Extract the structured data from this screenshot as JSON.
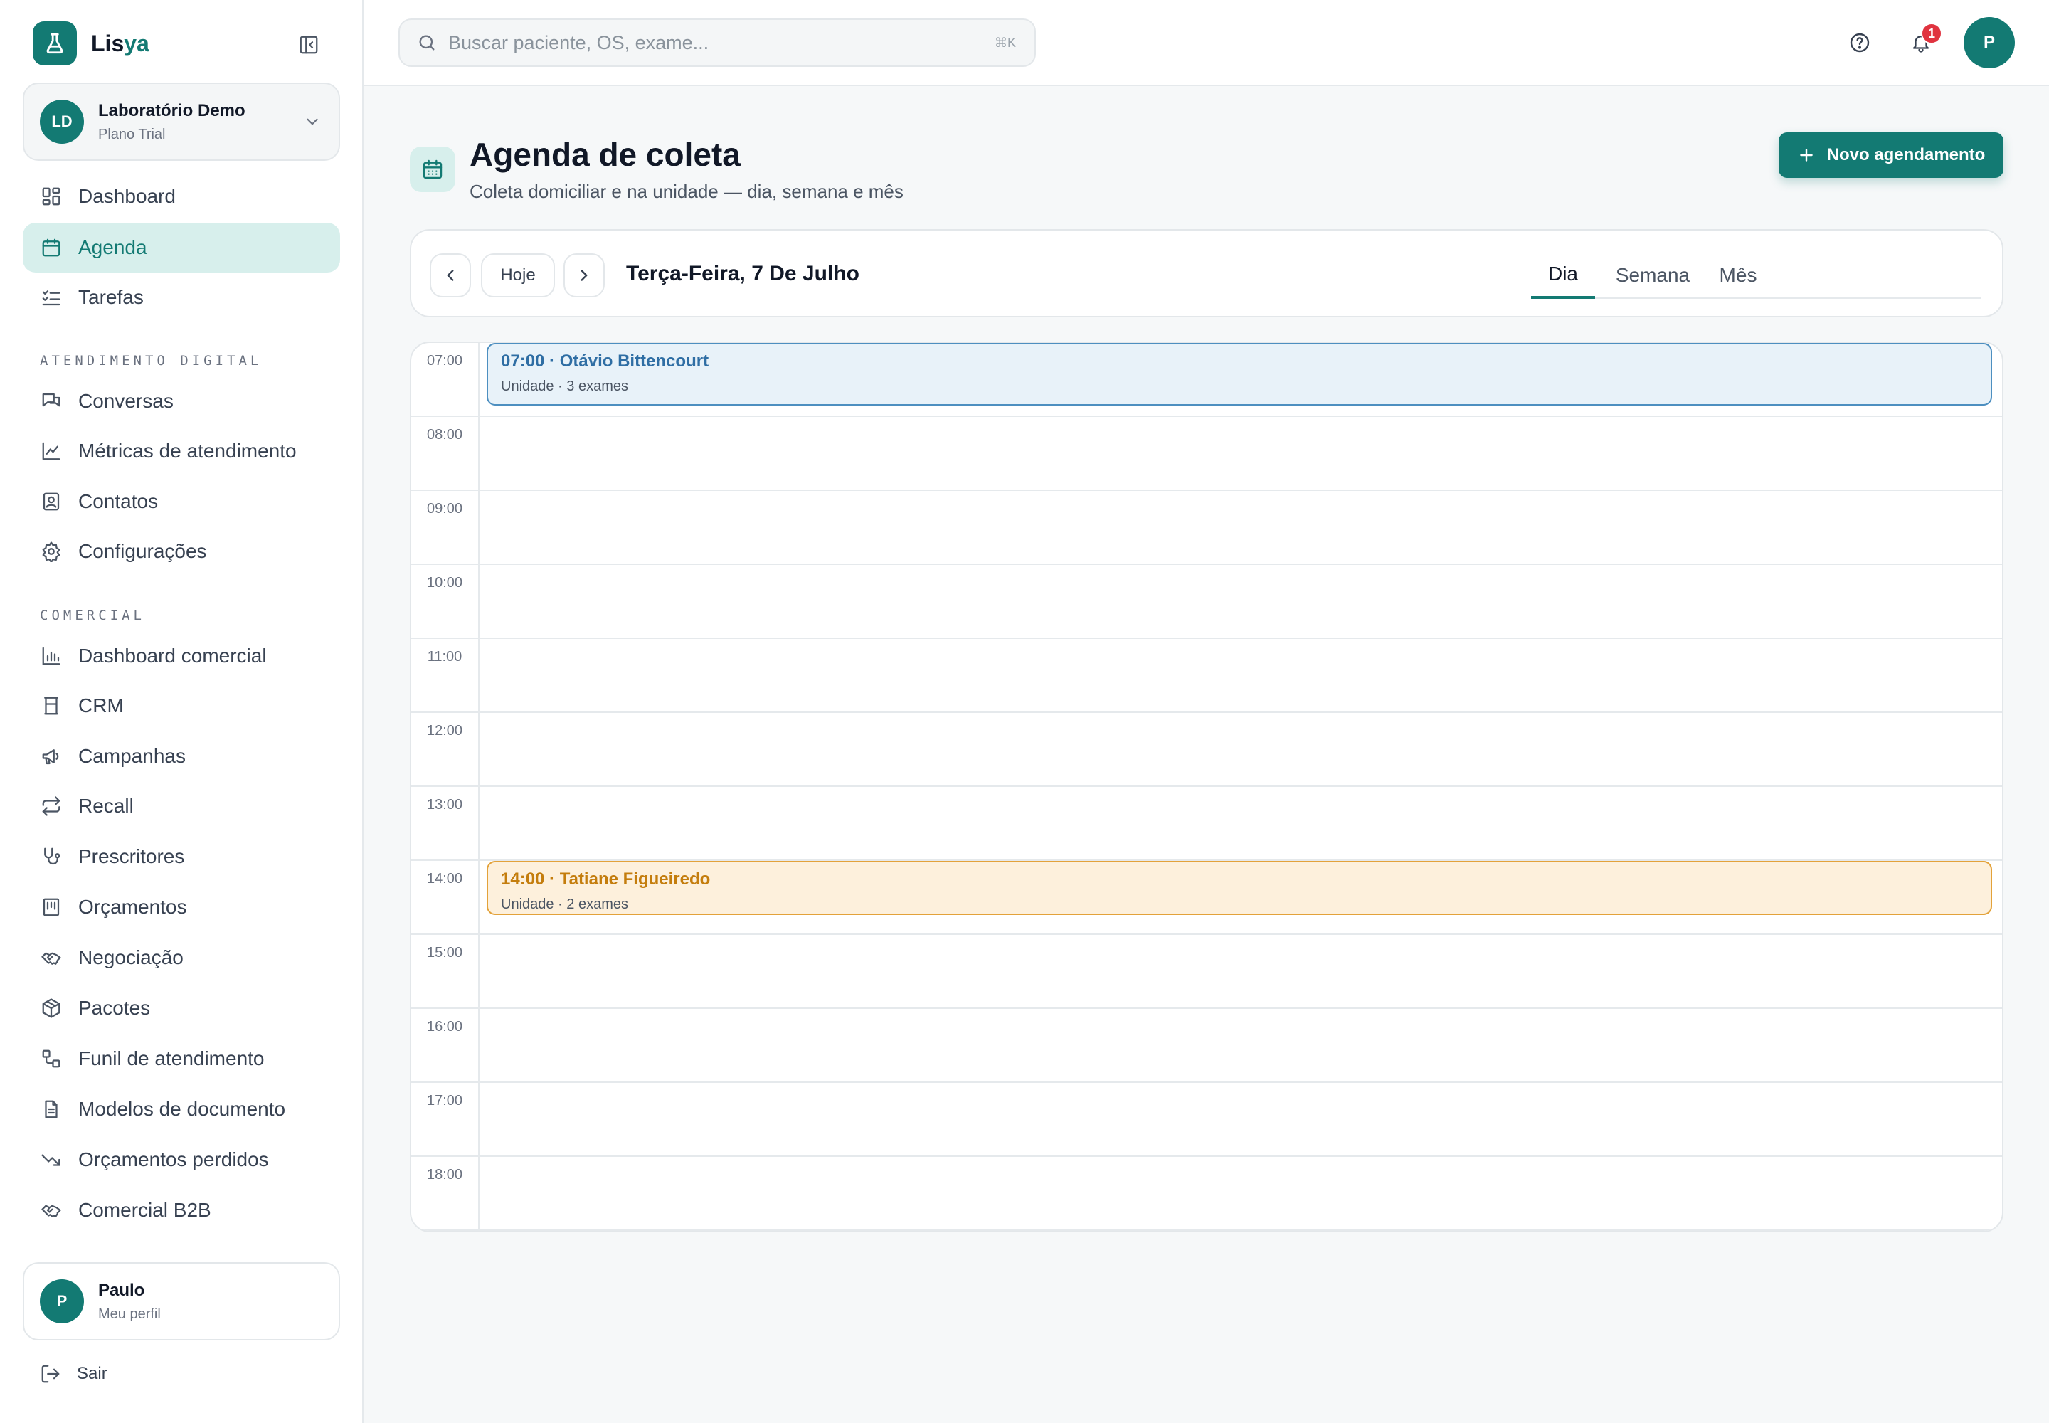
{
  "brand": {
    "name_part1": "Lis",
    "name_part2": "ya"
  },
  "org": {
    "initials": "LD",
    "name": "Laboratório Demo",
    "plan": "Plano Trial"
  },
  "nav": {
    "main": [
      {
        "label": "Dashboard",
        "icon": "dashboard-icon"
      },
      {
        "label": "Agenda",
        "icon": "calendar-icon",
        "active": true
      },
      {
        "label": "Tarefas",
        "icon": "tasks-icon"
      }
    ],
    "section_digital": "ATENDIMENTO DIGITAL",
    "digital": [
      {
        "label": "Conversas",
        "icon": "chat-icon"
      },
      {
        "label": "Métricas de atendimento",
        "icon": "line-chart-icon"
      },
      {
        "label": "Contatos",
        "icon": "contact-card-icon"
      },
      {
        "label": "Configurações",
        "icon": "gear-icon"
      }
    ],
    "section_comercial": "COMERCIAL",
    "comercial": [
      {
        "label": "Dashboard comercial",
        "icon": "bar-chart-icon"
      },
      {
        "label": "CRM",
        "icon": "crm-icon"
      },
      {
        "label": "Campanhas",
        "icon": "megaphone-icon"
      },
      {
        "label": "Recall",
        "icon": "repeat-icon"
      },
      {
        "label": "Prescritores",
        "icon": "stethoscope-icon"
      },
      {
        "label": "Orçamentos",
        "icon": "receipt-icon"
      },
      {
        "label": "Negociação",
        "icon": "handshake-icon"
      },
      {
        "label": "Pacotes",
        "icon": "package-icon"
      },
      {
        "label": "Funil de atendimento",
        "icon": "workflow-icon"
      },
      {
        "label": "Modelos de documento",
        "icon": "document-icon"
      },
      {
        "label": "Orçamentos perdidos",
        "icon": "trending-down-icon"
      },
      {
        "label": "Comercial B2B",
        "icon": "handshake-icon"
      }
    ]
  },
  "user": {
    "initial": "P",
    "name": "Paulo",
    "sub": "Meu perfil"
  },
  "logout_label": "Sair",
  "search": {
    "placeholder": "Buscar paciente, OS, exame...",
    "shortcut": "⌘K"
  },
  "notifications": {
    "count": "1"
  },
  "top_avatar_initial": "P",
  "page": {
    "title": "Agenda de coleta",
    "subtitle": "Coleta domiciliar e na unidade — dia, semana e mês",
    "new_button": "Novo agendamento"
  },
  "toolbar": {
    "today_label": "Hoje",
    "date_label": "Terça-Feira, 7 De Julho",
    "tabs": [
      "Dia",
      "Semana",
      "Mês"
    ],
    "active_tab": "Dia"
  },
  "colors": {
    "accent": "#137a73",
    "event_blue": "#4d8fc0",
    "event_orange": "#e3a23a",
    "badge": "#e0333f"
  },
  "hours": [
    "07:00",
    "08:00",
    "09:00",
    "10:00",
    "11:00",
    "12:00",
    "13:00",
    "14:00",
    "15:00",
    "16:00",
    "17:00",
    "18:00"
  ],
  "events": [
    {
      "hour": "07:00",
      "title": "07:00 · Otávio Bittencourt",
      "sub": "Unidade · 3 exames",
      "color": "blue"
    },
    {
      "hour": "14:00",
      "title": "14:00 · Tatiane Figueiredo",
      "sub": "Unidade · 2 exames",
      "color": "orange"
    }
  ]
}
